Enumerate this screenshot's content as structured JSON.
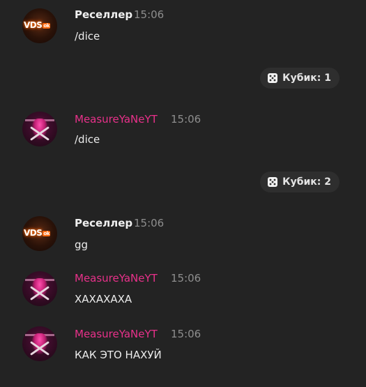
{
  "messages": [
    {
      "author": "Реселлер",
      "time": "15:06",
      "text": "/dice"
    },
    {
      "author": "MeasureYaNeYT",
      "time": "15:06",
      "text": "/dice"
    },
    {
      "author": "Реселлер",
      "time": "15:06",
      "text": "gg"
    },
    {
      "author": "MeasureYaNeYT",
      "time": "15:06",
      "text": "ХАХАХАХА"
    },
    {
      "author": "MeasureYaNeYT",
      "time": "15:06",
      "text": "КАК ЭТО НАХУЙ"
    }
  ],
  "dice_results": [
    {
      "label": "Кубик: 1"
    },
    {
      "label": "Кубик: 2"
    }
  ],
  "avatars": {
    "reseller": {
      "logo_text": "VDS",
      "logo_badge": "ok",
      "icon": "vds-logo-avatar"
    },
    "measure": {
      "icon": "skull-crossbones-avatar"
    }
  },
  "colors": {
    "background": "#232323",
    "author_white": "#f0f0f0",
    "author_pink": "#e8318a",
    "timestamp": "#8e8e8e",
    "pill_bg": "#2e2e2e"
  }
}
